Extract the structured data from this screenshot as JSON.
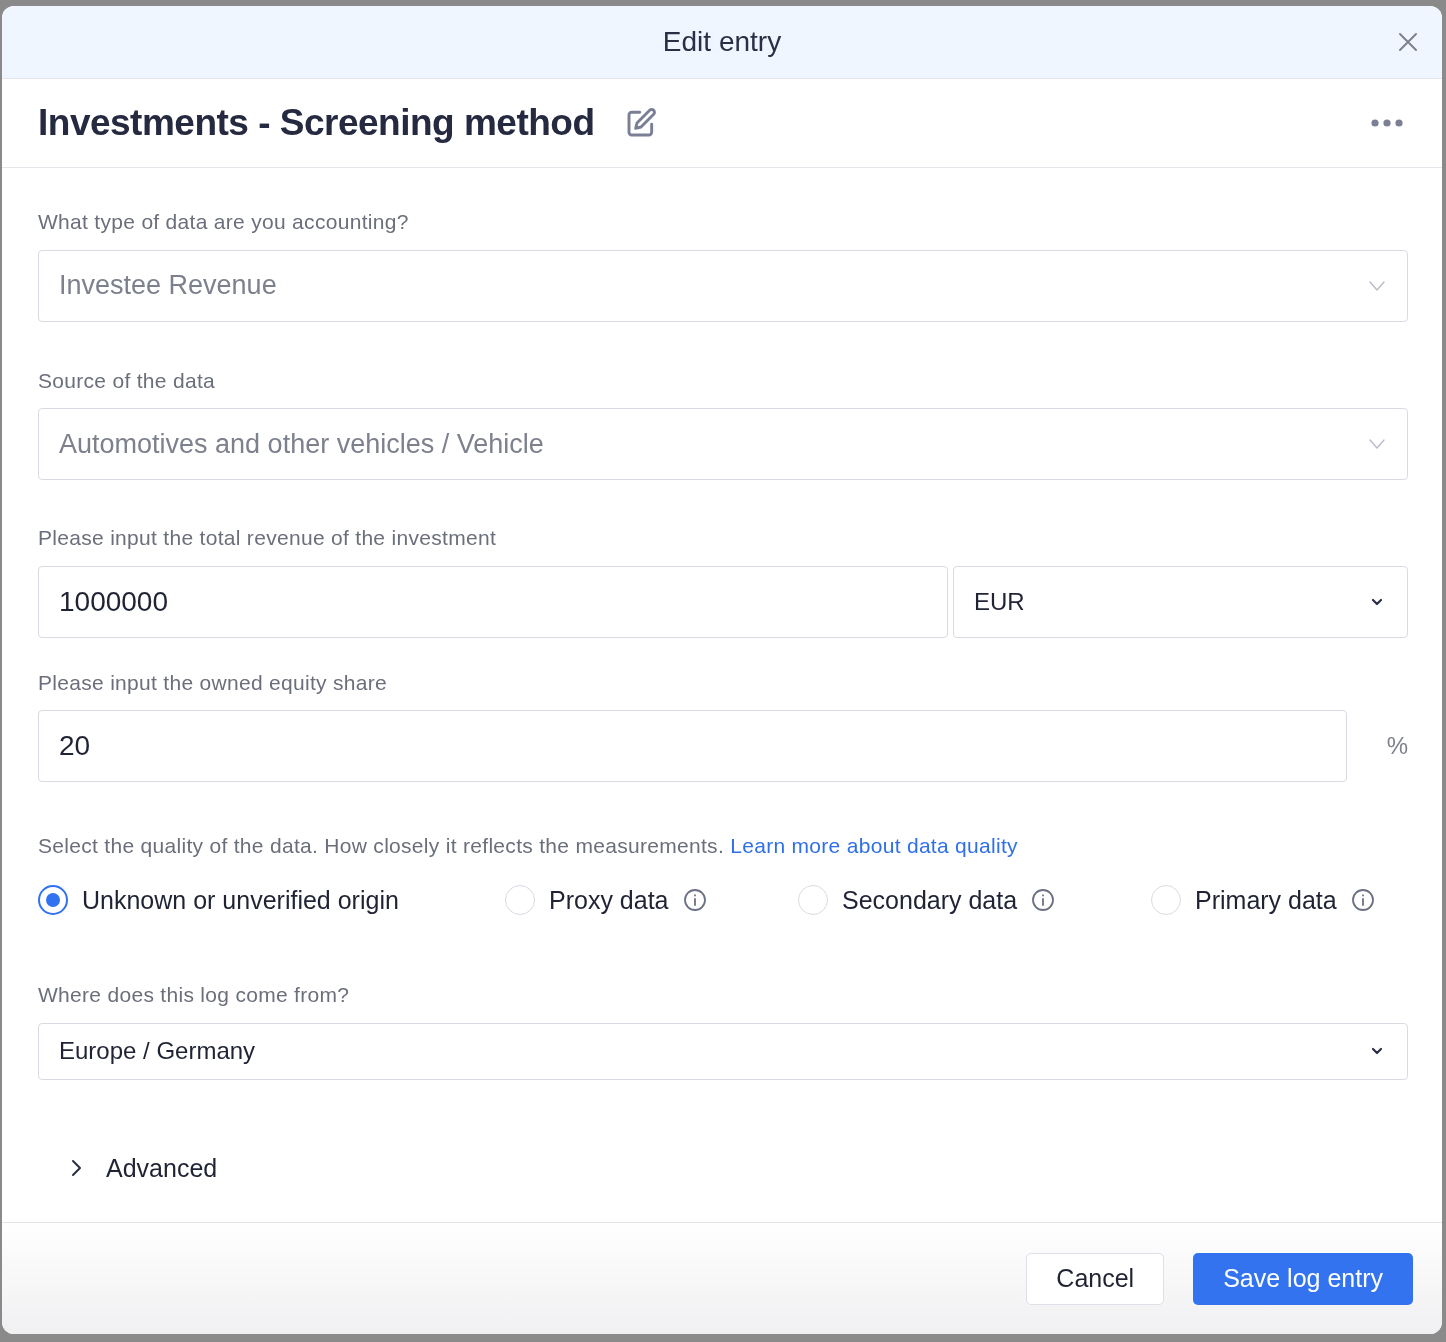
{
  "dialog": {
    "title": "Edit entry"
  },
  "entry": {
    "title": "Investments - Screening method"
  },
  "fields": [
    {
      "kind": "select",
      "label": "What type of data are you accounting?",
      "value": "Investee Revenue",
      "disabled": true
    },
    {
      "kind": "select",
      "label": "Source of the data",
      "value": "Automotives and other vehicles / Vehicle",
      "disabled": true
    },
    {
      "kind": "amount",
      "label": "Please input the total revenue of the investment",
      "value": "1000000",
      "unit": "EUR"
    },
    {
      "kind": "percent",
      "label": "Please input the owned equity share",
      "value": "20",
      "suffix": "%"
    },
    {
      "kind": "quality",
      "label": "Select the quality of the data. How closely it reflects the measurements.",
      "link": "Learn more about data quality",
      "options": [
        {
          "label": "Unknown or unverified origin",
          "selected": true,
          "info": false
        },
        {
          "label": "Proxy data",
          "selected": false,
          "info": true
        },
        {
          "label": "Secondary data",
          "selected": false,
          "info": true
        },
        {
          "label": "Primary data",
          "selected": false,
          "info": true
        }
      ]
    },
    {
      "kind": "select",
      "label": "Where does this log come from?",
      "value": "Europe / Germany",
      "disabled": false
    }
  ],
  "advanced": {
    "label": "Advanced",
    "expanded": false
  },
  "buttons": [
    {
      "label": "Cancel",
      "kind": "secondary"
    },
    {
      "label": "Save log entry",
      "kind": "primary"
    }
  ]
}
